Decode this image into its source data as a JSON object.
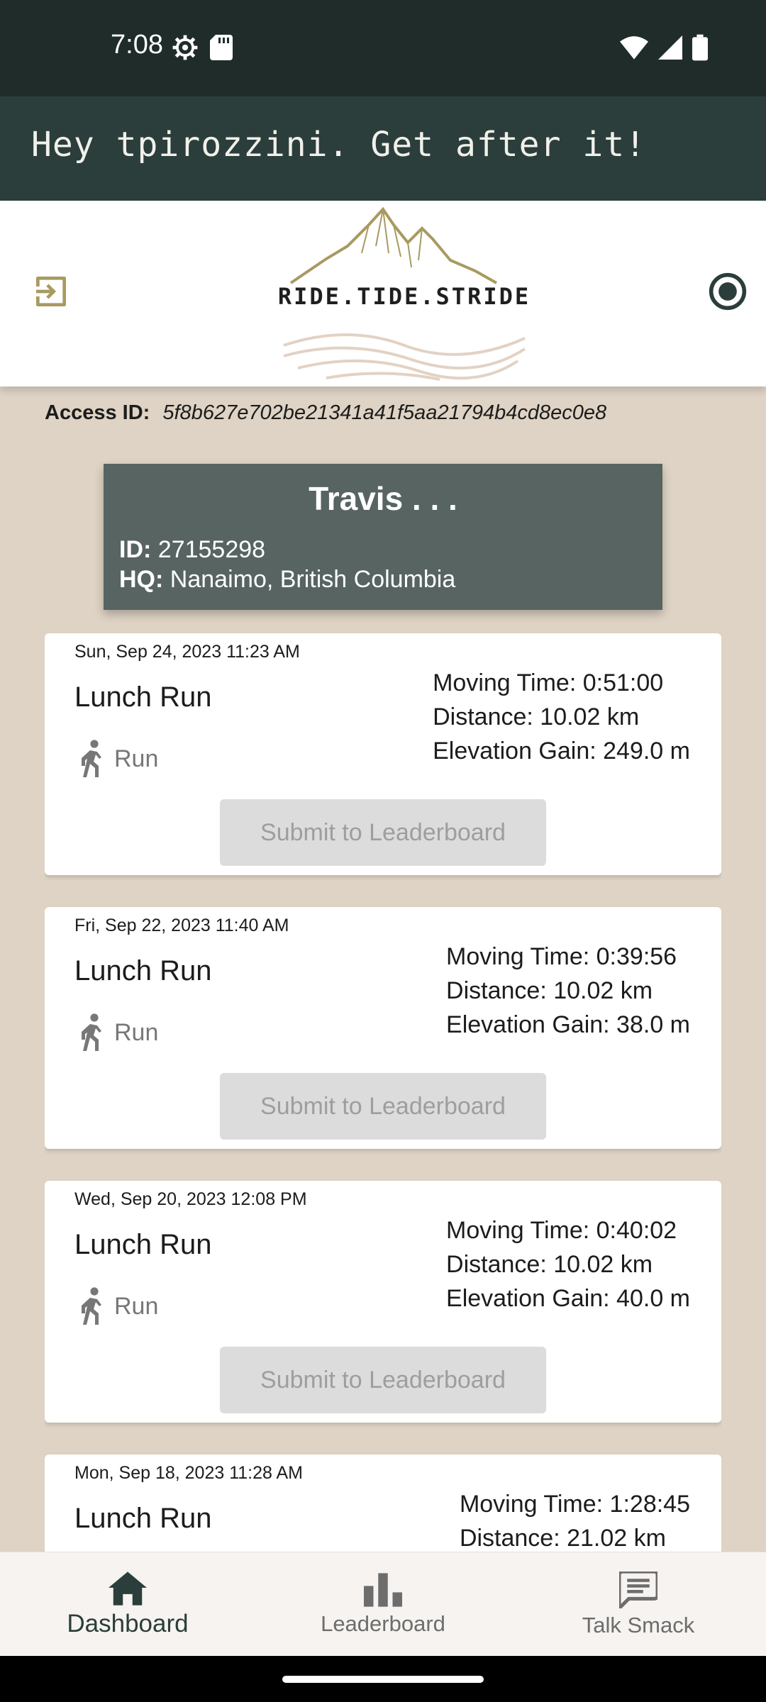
{
  "status_bar": {
    "time": "7:08",
    "icons_left": [
      "settings-gear-icon",
      "sd-card-icon"
    ],
    "icons_right": [
      "wifi-icon",
      "cellular-signal-icon",
      "battery-icon"
    ]
  },
  "greeting": "Hey tpirozzini. Get after it!",
  "header": {
    "logo_text": "RIDE.TIDE.STRIDE",
    "left_icon": "logout-icon",
    "right_icon": "record-icon"
  },
  "access": {
    "label": "Access ID:",
    "value": "5f8b627e702be21341a41f5aa21794b4cd8ec0e8"
  },
  "profile": {
    "name": "Travis . . .",
    "id_label": "ID:",
    "id_value": "27155298",
    "hq_label": "HQ:",
    "hq_value": "Nanaimo, British Columbia"
  },
  "activities": [
    {
      "date": "Sun, Sep 24, 2023 11:23 AM",
      "title": "Lunch Run",
      "type": "Run",
      "moving_time": "Moving Time: 0:51:00",
      "distance": "Distance: 10.02 km",
      "elevation": "Elevation Gain: 249.0 m",
      "button": "Submit to Leaderboard"
    },
    {
      "date": "Fri, Sep 22, 2023 11:40 AM",
      "title": "Lunch Run",
      "type": "Run",
      "moving_time": "Moving Time: 0:39:56",
      "distance": "Distance: 10.02 km",
      "elevation": "Elevation Gain: 38.0 m",
      "button": "Submit to Leaderboard"
    },
    {
      "date": "Wed, Sep 20, 2023 12:08 PM",
      "title": "Lunch Run",
      "type": "Run",
      "moving_time": "Moving Time: 0:40:02",
      "distance": "Distance: 10.02 km",
      "elevation": "Elevation Gain: 40.0 m",
      "button": "Submit to Leaderboard"
    },
    {
      "date": "Mon, Sep 18, 2023 11:28 AM",
      "title": "Lunch Run",
      "type": "Run",
      "moving_time": "Moving Time: 1:28:45",
      "distance": "Distance: 21.02 km",
      "elevation": "",
      "button": ""
    }
  ],
  "nav": {
    "items": [
      {
        "label": "Dashboard",
        "icon": "home-icon",
        "active": true
      },
      {
        "label": "Leaderboard",
        "icon": "bar-chart-icon",
        "active": false
      },
      {
        "label": "Talk Smack",
        "icon": "chat-icon",
        "active": false
      }
    ]
  },
  "colors": {
    "background": "#ded3c4",
    "banner": "#2b3e3b",
    "profile_card": "#576462",
    "accent_gold": "#a89a60"
  }
}
